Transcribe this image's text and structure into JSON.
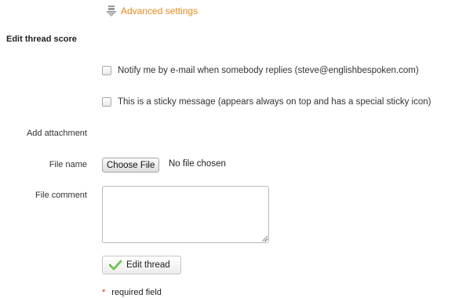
{
  "advanced": {
    "label": "Advanced settings",
    "icon": "down-arrow-icon",
    "color": "#e8891e"
  },
  "section": {
    "title": "Edit thread score"
  },
  "options": [
    {
      "label": "Notify me by e-mail when somebody replies (steve@englishbespoken.com)",
      "checked": false
    },
    {
      "label": "This is a sticky message (appears always on top and has a special sticky icon)",
      "checked": false
    }
  ],
  "attachment": {
    "heading": "Add attachment",
    "file_label": "File name",
    "choose_button": "Choose File",
    "file_status": "No file chosen",
    "comment_label": "File comment",
    "comment_value": ""
  },
  "submit": {
    "label": "Edit thread",
    "icon": "checkmark-icon",
    "icon_color": "#4caf2a"
  },
  "footer": {
    "required_marker": "*",
    "required_text": "required field",
    "marker_color": "#d9301f"
  }
}
